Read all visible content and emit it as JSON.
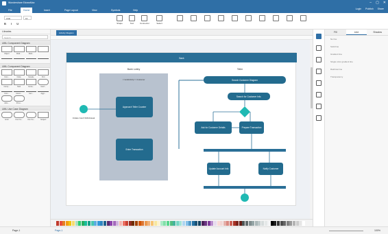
{
  "app": {
    "title": "Wondershare EdrawMax",
    "window_controls": [
      "–",
      "▢",
      "✕"
    ]
  },
  "menu": {
    "tabs": [
      "File",
      "Home",
      "Insert",
      "Page Layout",
      "View",
      "Symbols",
      "Help"
    ],
    "active_tab": "Home",
    "right_items": [
      "Login",
      "Publish",
      "Share"
    ]
  },
  "toolbar": {
    "font_name": "Arial",
    "font_size": "10",
    "tools": [
      "Shape",
      "Text",
      "Connector",
      "Select"
    ]
  },
  "library": {
    "header": "Libraries",
    "search_placeholder": "Search",
    "sections": [
      {
        "title": "UML Component Diagram",
        "labels": [
          "Object",
          "Multi...",
          "Multi...",
          "",
          "",
          "",
          "",
          ""
        ]
      },
      {
        "title": "UML Component Diagram",
        "labels": [
          "Com...",
          "Node",
          "Facade",
          "Port",
          "Comp...",
          "Stub",
          "Conte...",
          "Interf...",
          "Com...",
          "Assoc...",
          "Gen...",
          "Aggr...",
          "Attrs...",
          "Provi...",
          "",
          ""
        ]
      },
      {
        "title": "UML Use Case Diagram",
        "labels": [
          "Actor",
          "Use Ca...",
          "Use Ca...",
          "Subject"
        ]
      }
    ]
  },
  "document": {
    "tab": "Activity Diagram"
  },
  "diagram": {
    "title": "Bank",
    "lanes": [
      "Bank Lobby",
      "Teller"
    ],
    "nodes": {
      "start_label": "Initiate Cash Withdrawal",
      "partition": "<<subActivity>> Customer",
      "approach": "Approach Teller Counter",
      "enter": "Enter Transaction",
      "search_act": "Search Customer Diagram",
      "search_cust": "Search for Customer Info.",
      "ask": "Ask for Customer Details",
      "prepare": "Prepare Transaction",
      "update": "Update Account Info",
      "notify": "Notify Customer"
    },
    "colors": {
      "header": "#2a6f97",
      "node": "#236b8e",
      "accent": "#1fb9b3",
      "lane": "#b8c2cf"
    }
  },
  "right_panel": {
    "tabs": [
      "Fill",
      "Line",
      "Shadow"
    ],
    "active_tab": "Line",
    "rows": [
      "No line",
      "Solid line",
      "Gradient line",
      "Single color gradient line",
      "Rainbow line",
      "Transparency"
    ]
  },
  "palette": {
    "colors": [
      "#c0392b",
      "#e74c3c",
      "#e67e22",
      "#f39c12",
      "#f1c40f",
      "#f7dc6f",
      "#a9dfbf",
      "#2ecc71",
      "#27ae60",
      "#1abc9c",
      "#16a085",
      "#48c9b0",
      "#5dade2",
      "#3498db",
      "#2e86c1",
      "#1f618d",
      "#5b2c6f",
      "#8e44ad",
      "#a569bd",
      "#d2b4de",
      "#f5b7b1",
      "#ec7063",
      "#cb4335",
      "#922b21",
      "#6e2c00",
      "#a04000",
      "#d35400",
      "#dc7633",
      "#eb984e",
      "#f0b27a",
      "#f8c471",
      "#f9e79f",
      "#fcf3cf",
      "#abebc6",
      "#82e0aa",
      "#58d68d",
      "#52be80",
      "#45b39d",
      "#76d7c4",
      "#a3e4d7",
      "#aed6f1",
      "#85c1e9",
      "#5499c7",
      "#2471a3",
      "#1a5276",
      "#154360",
      "#4a235a",
      "#6c3483",
      "#7d3c98",
      "#bb8fce",
      "#e8daef",
      "#fadbd8",
      "#f2d7d5",
      "#e6b0aa",
      "#d98880",
      "#cd6155",
      "#a93226",
      "#7b241c",
      "#641e16",
      "#4d5656",
      "#616a6b",
      "#7f8c8d",
      "#95a5a6",
      "#aab7b8",
      "#bfc9ca",
      "#d5dbdb",
      "#e5e8e8",
      "#f2f3f4",
      "#000000",
      "#1c1c1c",
      "#333333",
      "#4d4d4d",
      "#666666",
      "#808080",
      "#999999",
      "#b3b3b3",
      "#cccccc",
      "#e6e6e6",
      "#ffffff"
    ]
  },
  "status": {
    "page_label": "Page-1",
    "page_tab": "Page-1",
    "zoom": "100%"
  }
}
